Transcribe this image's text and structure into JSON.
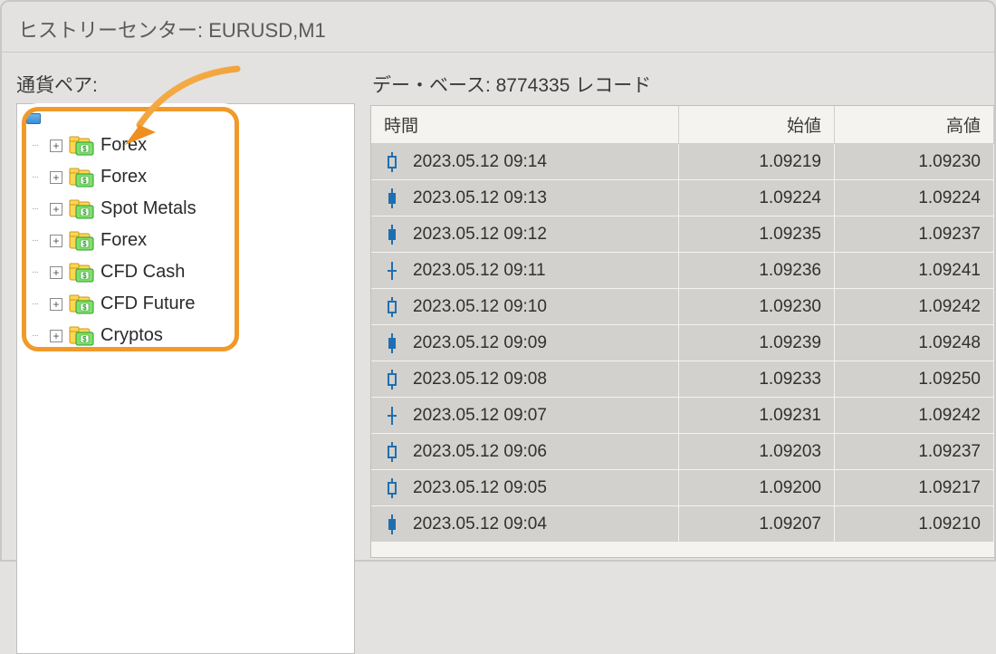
{
  "window": {
    "title": "ヒストリーセンター: EURUSD,M1"
  },
  "sidebar": {
    "label": "通貨ペア:",
    "items": [
      {
        "label": "Forex"
      },
      {
        "label": "Forex"
      },
      {
        "label": "Spot Metals"
      },
      {
        "label": "Forex"
      },
      {
        "label": "CFD Cash"
      },
      {
        "label": "CFD Future"
      },
      {
        "label": "Cryptos"
      }
    ]
  },
  "database": {
    "label_prefix": "デー・ベース: ",
    "record_count": "8774335",
    "label_suffix": " レコード",
    "columns": {
      "time": "時間",
      "open": "始値",
      "high": "高値"
    },
    "rows": [
      {
        "candle": "hollow",
        "time": "2023.05.12 09:14",
        "open": "1.09219",
        "high": "1.09230"
      },
      {
        "candle": "solid",
        "time": "2023.05.12 09:13",
        "open": "1.09224",
        "high": "1.09224"
      },
      {
        "candle": "solid",
        "time": "2023.05.12 09:12",
        "open": "1.09235",
        "high": "1.09237"
      },
      {
        "candle": "doji",
        "time": "2023.05.12 09:11",
        "open": "1.09236",
        "high": "1.09241"
      },
      {
        "candle": "hollow",
        "time": "2023.05.12 09:10",
        "open": "1.09230",
        "high": "1.09242"
      },
      {
        "candle": "solid",
        "time": "2023.05.12 09:09",
        "open": "1.09239",
        "high": "1.09248"
      },
      {
        "candle": "hollow",
        "time": "2023.05.12 09:08",
        "open": "1.09233",
        "high": "1.09250"
      },
      {
        "candle": "doji",
        "time": "2023.05.12 09:07",
        "open": "1.09231",
        "high": "1.09242"
      },
      {
        "candle": "hollow",
        "time": "2023.05.12 09:06",
        "open": "1.09203",
        "high": "1.09237"
      },
      {
        "candle": "hollow",
        "time": "2023.05.12 09:05",
        "open": "1.09200",
        "high": "1.09217"
      },
      {
        "candle": "solid",
        "time": "2023.05.12 09:04",
        "open": "1.09207",
        "high": "1.09210"
      }
    ]
  }
}
